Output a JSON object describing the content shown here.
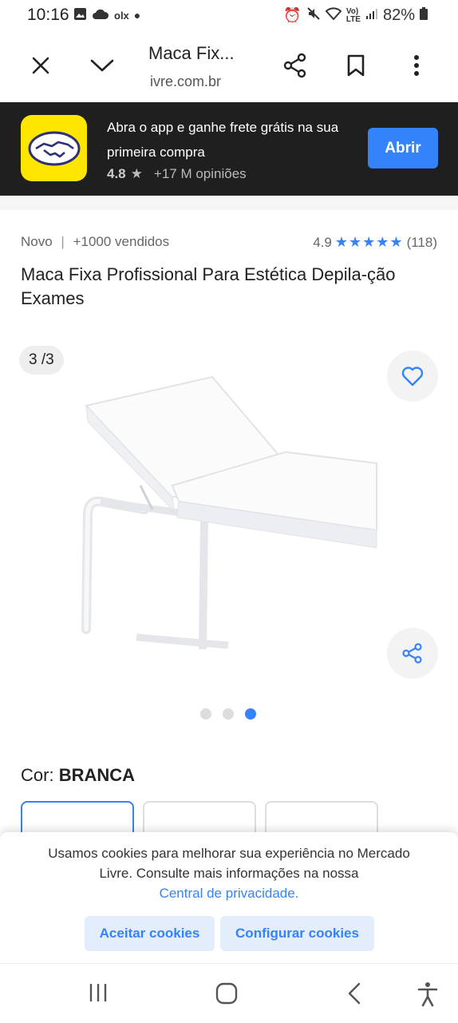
{
  "status_bar": {
    "time": "10:16",
    "app_label": "olx",
    "battery": "82%"
  },
  "toolbar": {
    "title": "Maca Fix...",
    "url": "ivre.com.br"
  },
  "banner": {
    "text": "Abra o app e ganhe frete grátis na sua primeira compra",
    "rating": "4.8",
    "opinions": "+17 M opiniões",
    "open_label": "Abrir"
  },
  "product": {
    "condition": "Novo",
    "sold": "+1000 vendidos",
    "rating_value": "4.9",
    "stars": "★★★★★",
    "review_count": "(118)",
    "title": "Maca Fixa Profissional Para Estética Depila-ção Exames",
    "image_counter": "3 /3",
    "color_label": "Cor:",
    "color_value": "BRANCA",
    "active_image_index": 3,
    "image_count": 3
  },
  "cookie": {
    "text": "Usamos cookies para melhorar sua experiência no Mercado Livre. Consulte mais informações na nossa",
    "link": "Central de privacidade.",
    "accept_label": "Aceitar cookies",
    "configure_label": "Configurar cookies"
  },
  "colors": {
    "accent": "#3483fa",
    "banner_bg": "#1f1f1f",
    "logo_yellow": "#ffe600"
  }
}
